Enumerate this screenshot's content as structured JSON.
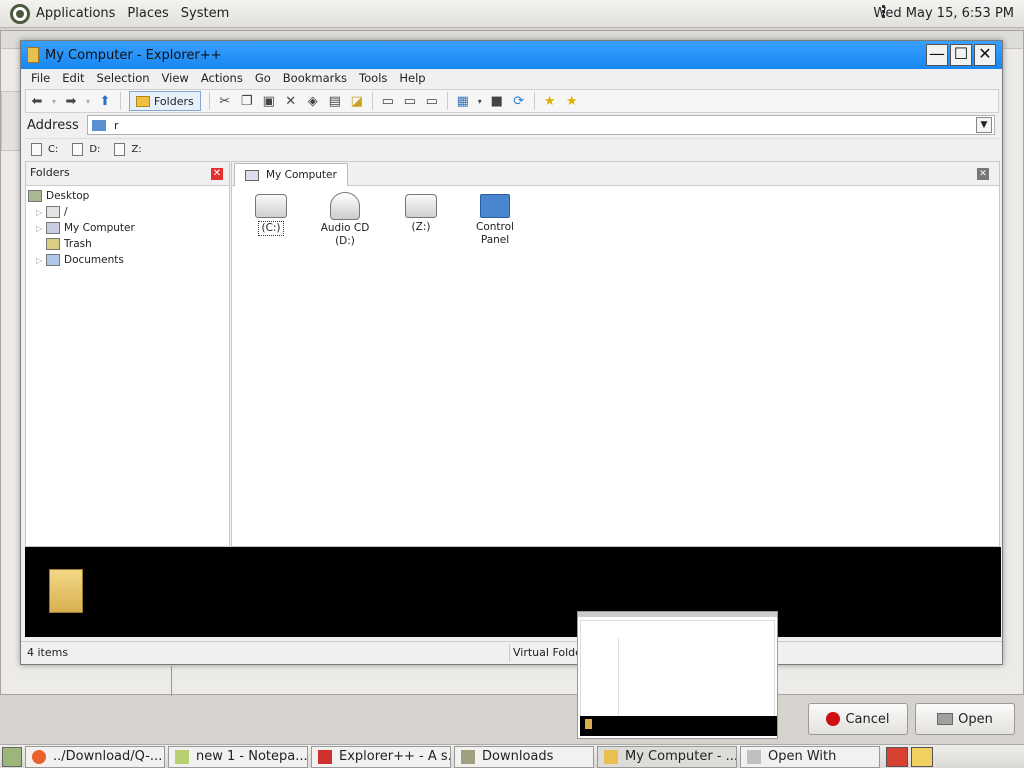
{
  "top_panel": {
    "menus": [
      "Applications",
      "Places",
      "System"
    ],
    "clock": "Wed May 15,  6:53 PM"
  },
  "window": {
    "title": "My Computer - Explorer++",
    "controls": {
      "minimize": "—",
      "maximize": "☐",
      "close": "✕"
    },
    "menubar": [
      "File",
      "Edit",
      "Selection",
      "View",
      "Actions",
      "Go",
      "Bookmarks",
      "Tools",
      "Help"
    ],
    "toolbar": {
      "folders_label": "Folders"
    },
    "address": {
      "label": "Address",
      "value": "r"
    },
    "drives": [
      "C:",
      "D:",
      "Z:"
    ],
    "folders_pane": {
      "title": "Folders",
      "tree": [
        "Desktop",
        "/",
        "My Computer",
        "Trash",
        "Documents"
      ]
    },
    "tab": {
      "label": "My Computer"
    },
    "items": [
      {
        "label": "(C:)",
        "icon": "hard-drive-icon"
      },
      {
        "label": "Audio CD\n(D:)",
        "label1": "Audio CD",
        "label2": "(D:)",
        "icon": "cd-drive-icon"
      },
      {
        "label": "(Z:)",
        "icon": "hard-drive-icon"
      },
      {
        "label1": "Control",
        "label2": "Panel",
        "icon": "control-panel-icon"
      }
    ],
    "status": {
      "count": "4 items",
      "location": "Virtual Folder"
    }
  },
  "dialog": {
    "cancel": "Cancel",
    "open": "Open"
  },
  "taskbar": {
    "tasks": [
      "../Download/Q-...",
      "new 1 - Notepa...",
      "Explorer++ - A s...",
      "Downloads",
      "My Computer - ...",
      "Open With"
    ]
  }
}
